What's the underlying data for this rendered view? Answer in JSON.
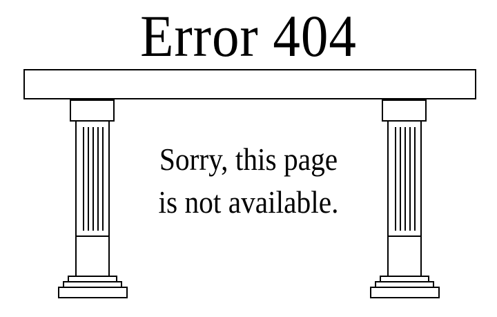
{
  "page": {
    "title": "Error 404",
    "message_line1": "Sorry, this page",
    "message_line2": "is not available."
  },
  "colors": {
    "ink": "#000000",
    "background": "#ffffff"
  },
  "icons": {
    "temple_illustration": "greek-temple-columns-icon"
  }
}
